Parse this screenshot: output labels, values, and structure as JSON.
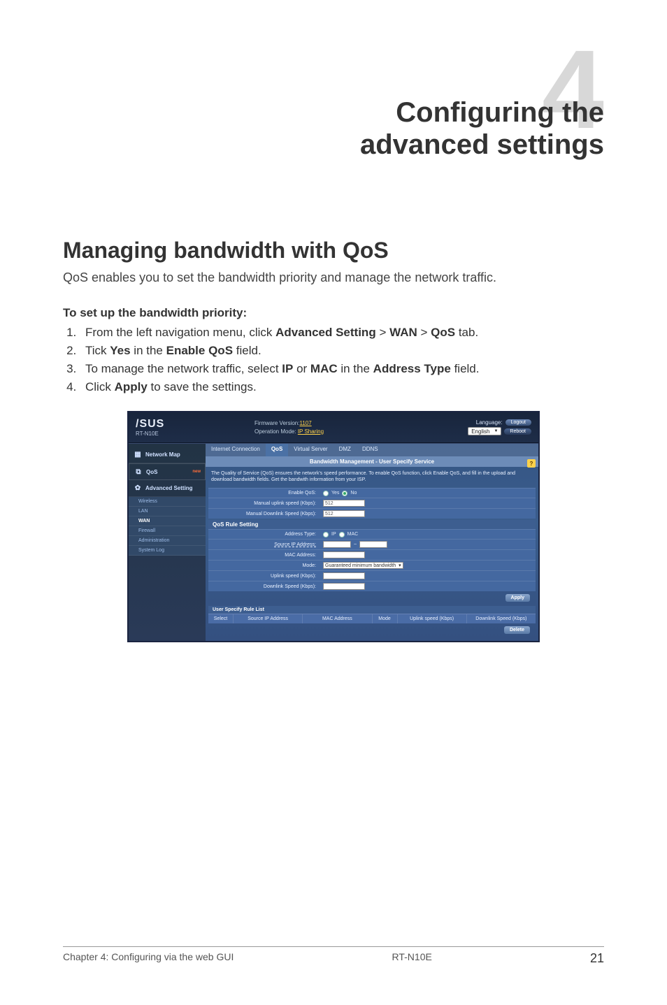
{
  "chapter": {
    "number": "4",
    "title_l1": "Configuring the",
    "title_l2": "advanced settings"
  },
  "section": {
    "heading": "Managing bandwidth with QoS",
    "intro": "QoS enables you to set the bandwidth priority and manage the network traffic."
  },
  "steps_header": "To set up the bandwidth priority:",
  "steps": {
    "s1_pre": "From the left navigation menu, click ",
    "s1_b1": "Advanced Setting",
    "s1_gt1": " > ",
    "s1_b2": "WAN",
    "s1_gt2": " > ",
    "s1_b3": "QoS",
    "s1_post": " tab.",
    "s2_pre": "Tick ",
    "s2_b1": "Yes",
    "s2_mid": " in the ",
    "s2_b2": "Enable QoS",
    "s2_post": " field.",
    "s3_pre": "To manage the network traffic, select ",
    "s3_b1": "IP",
    "s3_mid1": " or ",
    "s3_b2": "MAC",
    "s3_mid2": " in the ",
    "s3_b3": "Address Type",
    "s3_post": " field.",
    "s4_pre": "Click ",
    "s4_b1": "Apply",
    "s4_post": " to save the settings."
  },
  "screenshot": {
    "brand": "/SUS",
    "model": "RT-N10E",
    "fw_label": "Firmware Version:",
    "fw_value": "1107",
    "opmode_label": "Operation Mode:",
    "opmode_value": "IP Sharing",
    "lang_label": "Language:",
    "lang_value": "English",
    "logout": "Logout",
    "reboot": "Reboot",
    "side": {
      "netmap": "Network Map",
      "qos": "QoS",
      "new": "new",
      "adv": "Advanced Setting",
      "wireless": "Wireless",
      "lan": "LAN",
      "wan": "WAN",
      "firewall": "Firewall",
      "admin": "Administration",
      "syslog": "System Log"
    },
    "tabs": {
      "t1": "Internet Connection",
      "t2": "QoS",
      "t3": "Virtual Server",
      "t4": "DMZ",
      "t5": "DDNS"
    },
    "panel_title": "Bandwidth Management - User Specify Service",
    "help": "?",
    "panel_desc": "The Quality of Service (QoS) ensures the network's speed performance. To enable QoS function, click Enable QoS, and fill in the upload and download bandwidth fields. Get the bandwith information from your ISP.",
    "enable_qos": "Enable QoS:",
    "yes": "Yes",
    "no": "No",
    "man_up": "Manual uplink speed (Kbps):",
    "man_up_v": "512",
    "man_dn": "Manual Downlink Speed (Kbps):",
    "man_dn_v": "512",
    "rule_hdr": "QoS Rule Setting",
    "addr_type": "Address Type:",
    "ip": "IP",
    "mac": "MAC",
    "src_ip": "Source IP Address:",
    "mac_addr": "MAC Address:",
    "mode": "Mode:",
    "mode_v": "Guaranteed minimum bandwidth",
    "up": "Uplink speed (Kbps):",
    "dn": "Downlink Speed (Kbps):",
    "apply": "Apply",
    "list_hdr": "User Specify Rule List",
    "cols": {
      "c1": "Select",
      "c2": "Source IP Address",
      "c3": "MAC Address",
      "c4": "Mode",
      "c5": "Uplink speed (Kbps)",
      "c6": "Downlink Speed (Kbps)"
    },
    "delete": "Delete"
  },
  "footer": {
    "left": "Chapter 4: Configuring via the web GUI",
    "model": "RT-N10E",
    "page": "21"
  }
}
